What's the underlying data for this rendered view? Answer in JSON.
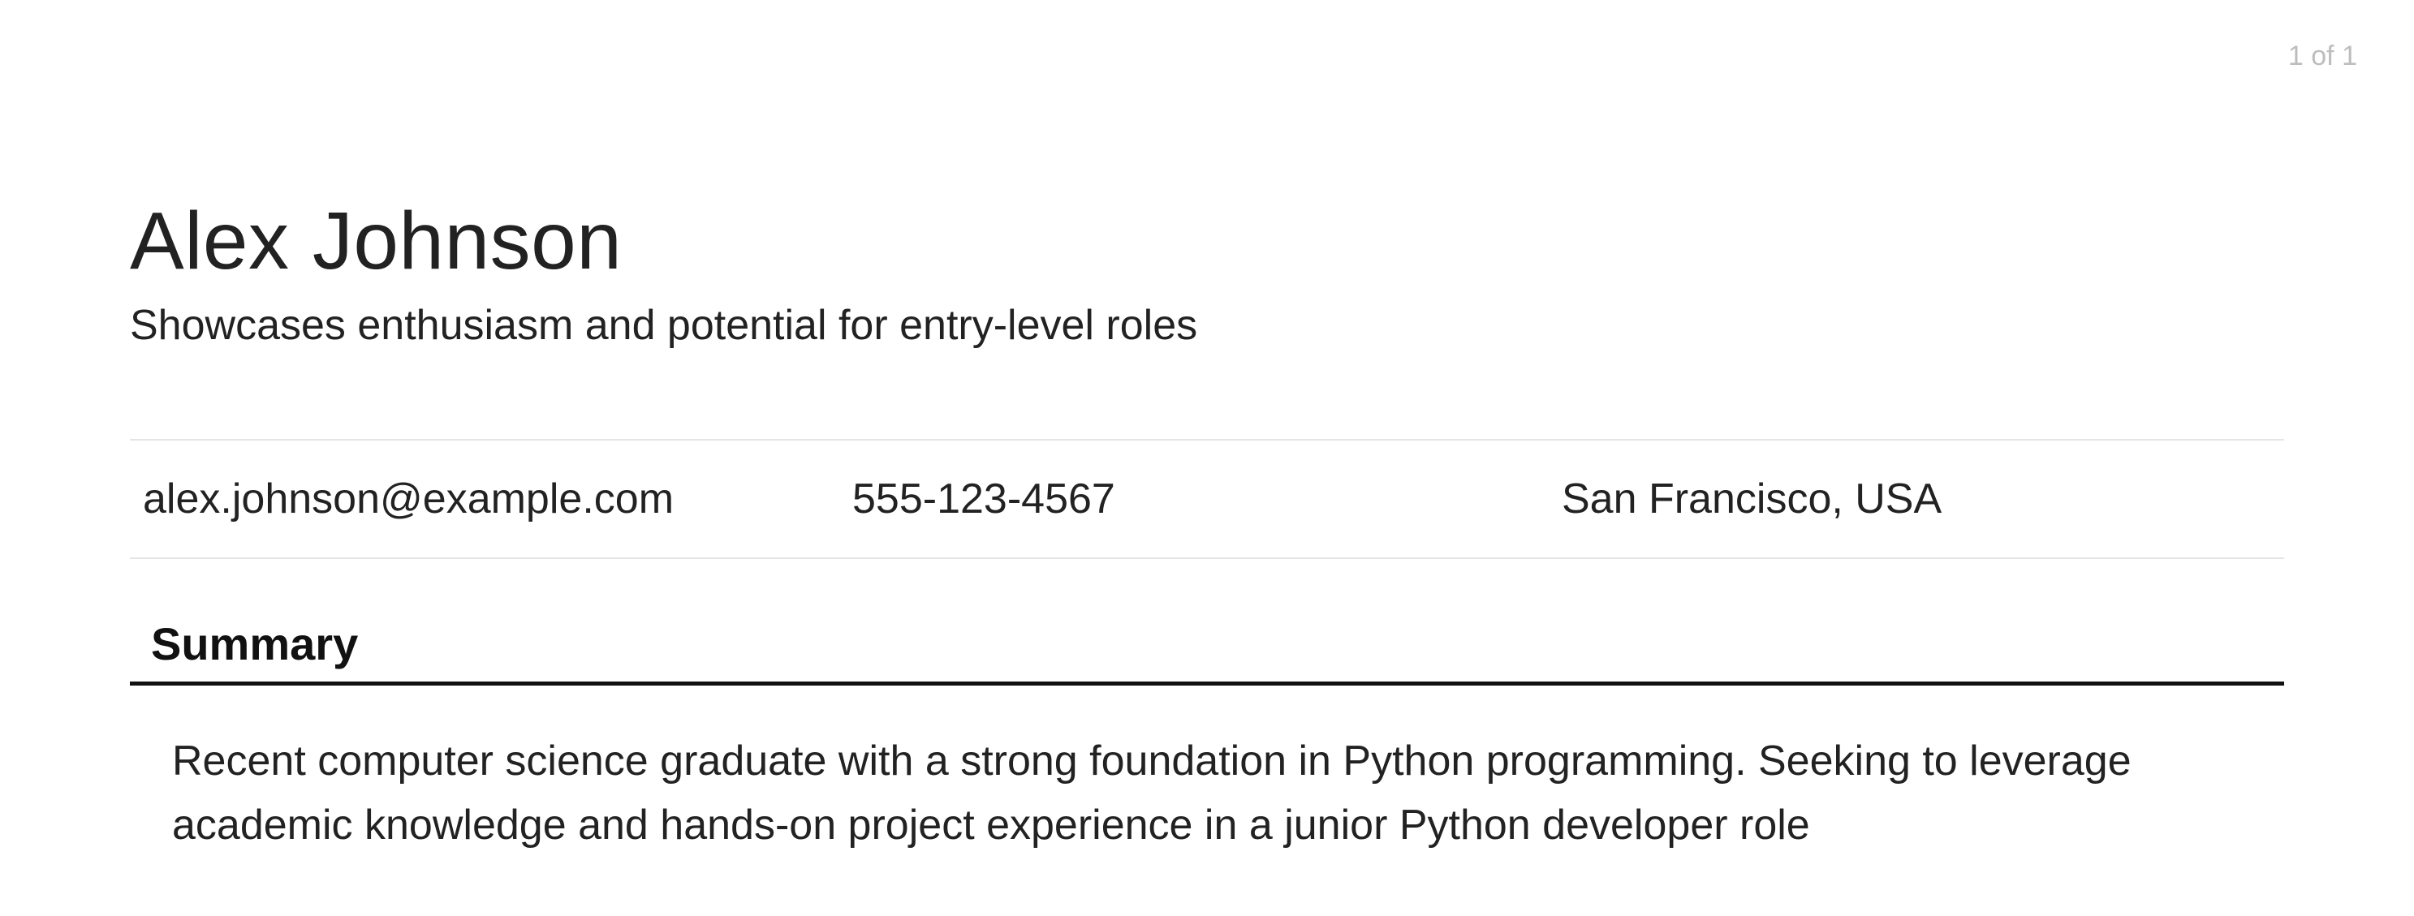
{
  "pageCounter": "1 of 1",
  "header": {
    "name": "Alex Johnson",
    "tagline": "Showcases enthusiasm and potential for entry-level roles"
  },
  "contact": {
    "email": "alex.johnson@example.com",
    "phone": "555-123-4567",
    "location": "San Francisco, USA"
  },
  "sections": {
    "summary": {
      "title": "Summary",
      "body": "Recent computer science graduate with a strong foundation in Python programming. Seeking to leverage academic knowledge and hands-on project experience in a junior Python developer role"
    }
  }
}
